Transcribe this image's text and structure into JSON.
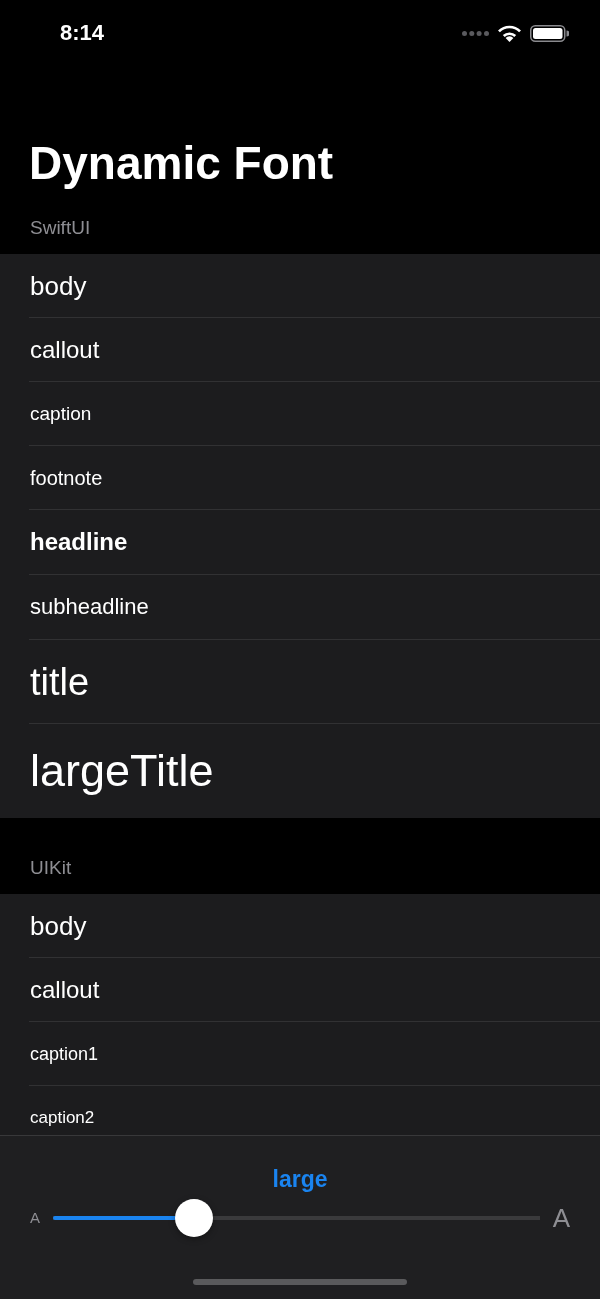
{
  "status_bar": {
    "time": "8:14"
  },
  "title": "Dynamic Font",
  "sections": [
    {
      "header": "SwiftUI",
      "items": [
        {
          "label": "body",
          "kind": "body"
        },
        {
          "label": "callout",
          "kind": "callout"
        },
        {
          "label": "caption",
          "kind": "caption"
        },
        {
          "label": "footnote",
          "kind": "footnote"
        },
        {
          "label": "headline",
          "kind": "headline"
        },
        {
          "label": "subheadline",
          "kind": "subheadline"
        },
        {
          "label": "title",
          "kind": "title"
        },
        {
          "label": "largeTitle",
          "kind": "large_title"
        }
      ]
    },
    {
      "header": "UIKit",
      "items": [
        {
          "label": "body",
          "kind": "body"
        },
        {
          "label": "callout",
          "kind": "callout"
        },
        {
          "label": "caption1",
          "kind": "caption1"
        },
        {
          "label": "caption2",
          "kind": "caption2"
        }
      ]
    }
  ],
  "size_panel": {
    "size_name": "large",
    "min_label": "A",
    "max_label": "A",
    "slider": {
      "level": 0.29
    }
  }
}
